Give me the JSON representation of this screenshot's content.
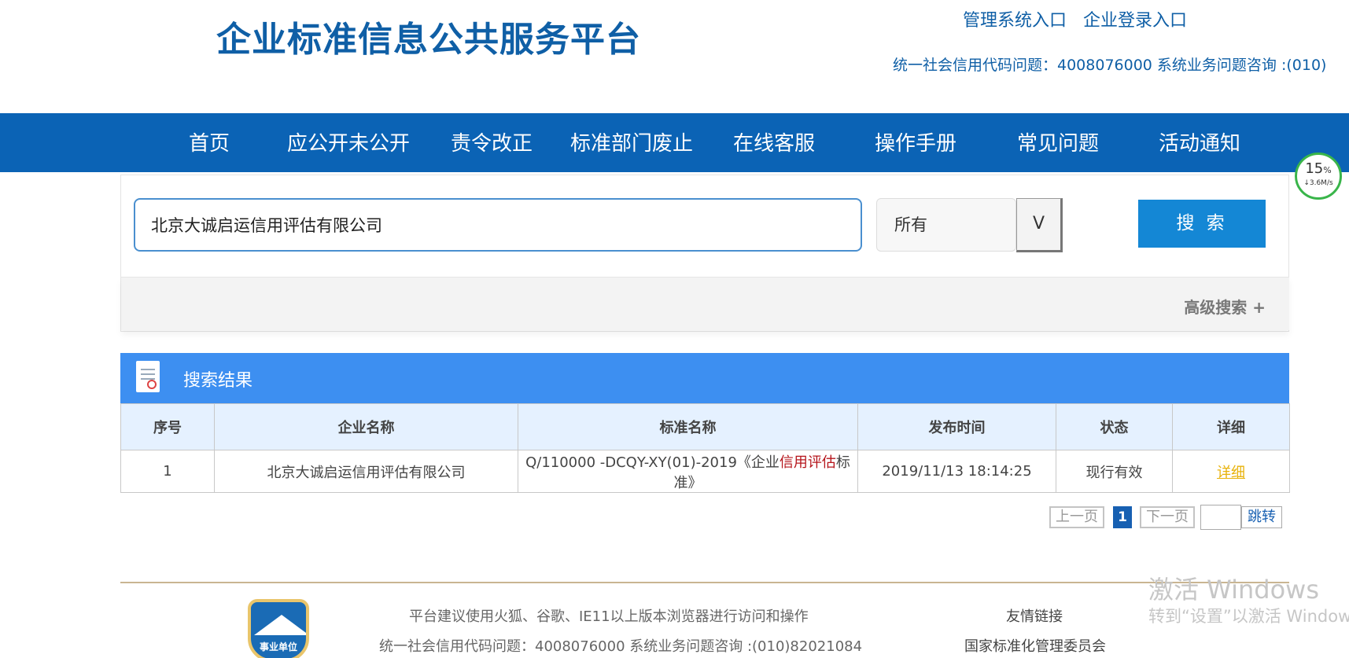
{
  "header": {
    "site_title": "企业标准信息公共服务平台",
    "links": [
      "管理系统入口",
      "企业登录入口"
    ],
    "hotline": "统一社会信用代码问题：4008076000 系统业务问题咨询 :(010)"
  },
  "nav": {
    "items": [
      "首页",
      "应公开未公开",
      "责令改正",
      "标准部门废止",
      "在线客服",
      "操作手册",
      "常见问题",
      "活动通知"
    ]
  },
  "speed_widget": {
    "percent": "15",
    "percent_sign": "%",
    "rate": "↓3.6M/s"
  },
  "search": {
    "query": "北京大诚启运信用评估有限公司",
    "scope_selected": "所有",
    "dropdown_label": "V",
    "button_label": "搜 索",
    "advanced_label": "高级搜索 +"
  },
  "results": {
    "title": "搜索结果",
    "columns": [
      "序号",
      "企业名称",
      "标准名称",
      "发布时间",
      "状态",
      "详细"
    ],
    "rows": [
      {
        "index": "1",
        "company": "北京大诚启运信用评估有限公司",
        "standard_prefix": "Q/110000 -DCQY-XY(01)-2019《企业",
        "standard_highlight": "信用评估",
        "standard_suffix": "标准》",
        "published": "2019/11/13 18:14:25",
        "status": "现行有效",
        "detail": "详细"
      }
    ]
  },
  "pagination": {
    "prev": "上一页",
    "current": "1",
    "next": "下一页",
    "jump": "跳转"
  },
  "footer": {
    "browser_tip": "平台建议使用火狐、谷歌、IE11以上版本浏览器进行访问和操作",
    "hotline": "统一社会信用代码问题：4008076000 系统业务问题咨询 :(010)82021084",
    "friend_links_title": "友情链接",
    "friend_link_1": "国家标准化管理委员会",
    "badge_text": "事业单位"
  },
  "watermark": {
    "line1": "激活 Windows",
    "line2": "转到“设置”以激活 Windows"
  },
  "colors": {
    "brand_blue": "#0f5fa6",
    "nav_blue": "#0b63b5",
    "search_button": "#1487d5",
    "results_header": "#3d8ff1",
    "company_red": "#b5141b",
    "detail_link": "#e8b20a"
  }
}
